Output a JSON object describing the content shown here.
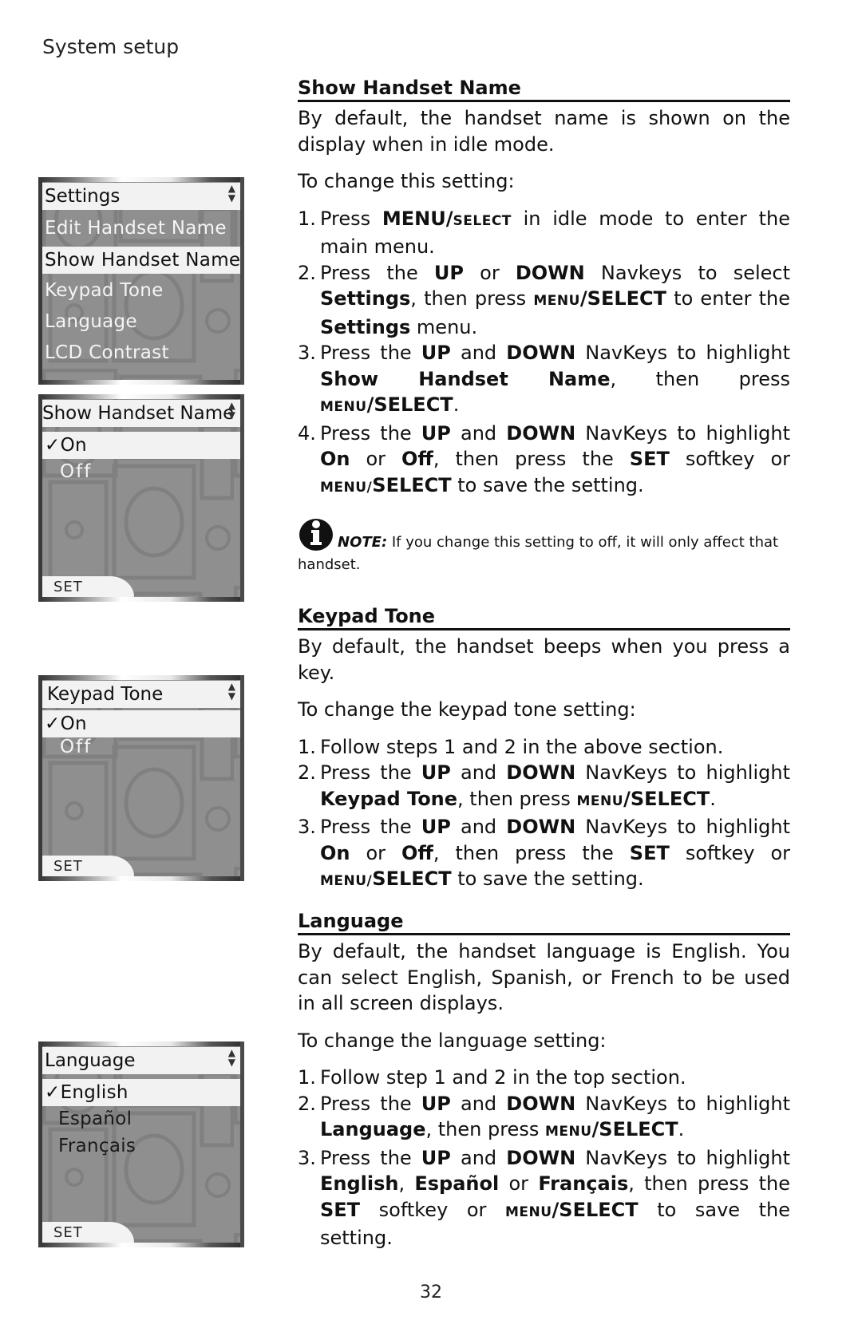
{
  "running_head": "System setup",
  "page_number": "32",
  "screens": [
    {
      "title": "Settings",
      "items": [
        "Edit Handset Name",
        "Show Handset Name",
        "Keypad Tone",
        "Language",
        "LCD Contrast"
      ],
      "selected": "Show Handset Name",
      "softkey": null
    },
    {
      "title": "Show Handset Name",
      "items": [
        "On",
        "Off"
      ],
      "checked": "On",
      "check_mark": "✓",
      "softkey": "SET"
    },
    {
      "title": "Keypad Tone",
      "items": [
        "On",
        "Off"
      ],
      "checked": "On",
      "check_mark": "✓",
      "softkey": "SET"
    },
    {
      "title": "Language",
      "items": [
        "English",
        "Español",
        "Français"
      ],
      "checked": "English",
      "check_mark": "✓",
      "softkey": "SET"
    }
  ],
  "sections": {
    "show_handset_name": {
      "heading": "Show Handset Name",
      "intro": "By default, the handset name is shown on the display when in idle mode.",
      "lead": "To change this setting:",
      "steps": [
        {
          "n": "1.",
          "parts": [
            "Press ",
            "MENU/",
            "SELECT",
            " in idle mode to enter the main menu."
          ]
        },
        {
          "n": "2.",
          "parts": [
            "Press the ",
            "UP",
            " or ",
            "DOWN",
            " Navkeys to select ",
            "Settings",
            ", then press ",
            "MENU",
            "/SELECT",
            " to enter the ",
            "Settings",
            " menu."
          ]
        },
        {
          "n": "3.",
          "parts": [
            "Press the ",
            "UP",
            " and ",
            "DOWN",
            " NavKeys to highlight ",
            "Show Handset Name",
            ", then press ",
            "MENU",
            "/SELECT",
            "."
          ]
        },
        {
          "n": "4.",
          "parts": [
            "Press the ",
            "UP",
            " and ",
            "DOWN",
            " NavKeys to highlight ",
            "On",
            " or ",
            "Off",
            ", then press the ",
            "SET",
            " softkey or ",
            "MENU/",
            "SELECT",
            " to save the setting."
          ]
        }
      ],
      "note_label": "NOTE:",
      "note_text": " If you change this setting to off, it will only affect that handset."
    },
    "keypad_tone": {
      "heading": "Keypad Tone",
      "intro": "By default, the handset beeps when you press a key.",
      "lead": "To change the keypad tone setting:",
      "steps": [
        {
          "n": "1.",
          "parts": [
            "Follow steps 1 and 2 in the above section."
          ]
        },
        {
          "n": "2.",
          "parts": [
            "Press the ",
            "UP",
            " and ",
            "DOWN",
            " NavKeys to highlight ",
            "Keypad Tone",
            ", then press ",
            "MENU",
            "/SELECT",
            "."
          ]
        },
        {
          "n": "3.",
          "parts": [
            "Press the ",
            "UP",
            " and ",
            "DOWN",
            " NavKeys to highlight ",
            "On",
            " or ",
            "Off",
            ", then press the ",
            "SET",
            " softkey or ",
            "MENU/",
            "SELECT",
            " to save the setting."
          ]
        }
      ]
    },
    "language": {
      "heading": "Language",
      "intro": "By default, the handset language is English. You can select English, Spanish, or French to be used in all screen displays.",
      "lead": "To change the language setting:",
      "steps": [
        {
          "n": "1.",
          "parts": [
            "Follow step 1 and 2 in the top section."
          ]
        },
        {
          "n": "2.",
          "parts": [
            "Press the ",
            "UP",
            " and ",
            "DOWN",
            " NavKeys to highlight ",
            "Language",
            ", then press ",
            "MENU",
            "/SELECT",
            "."
          ]
        },
        {
          "n": "3.",
          "parts": [
            "Press the ",
            "UP",
            " and ",
            "DOWN",
            " NavKeys to highlight ",
            "English",
            ", ",
            "Español",
            " or ",
            "Français",
            ", then press the ",
            "SET",
            " softkey or ",
            "MENU",
            "/SELECT",
            " to save the setting."
          ]
        }
      ]
    }
  }
}
